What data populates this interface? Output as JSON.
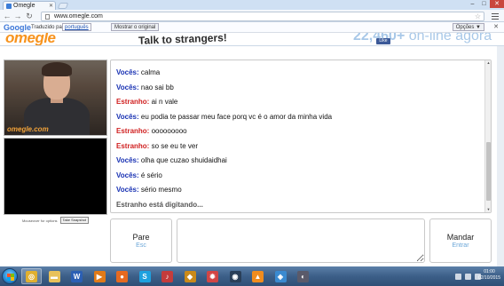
{
  "browser": {
    "tab_title": "Omegle",
    "url": "www.omegle.com",
    "translate_bar": {
      "logo": "Google",
      "label": "Traduzido para:",
      "language": "português",
      "show_original": "Mostrar o original",
      "options": "Opções ▼"
    }
  },
  "header": {
    "logo": "omegle",
    "tagline": "Talk to strangers!",
    "online_count": "22,460+",
    "online_label": " on-line agora",
    "like_label": "Like"
  },
  "video": {
    "watermark": "omegle.com",
    "footer_text": "Mouseover for options",
    "snapshot_button": "Take Snapshot"
  },
  "chat": {
    "messages": [
      {
        "sender": "Vocês:",
        "role": "you",
        "text": " calma"
      },
      {
        "sender": "Vocês:",
        "role": "you",
        "text": " nao sai bb"
      },
      {
        "sender": "Estranho:",
        "role": "stranger",
        "text": " ai n vale"
      },
      {
        "sender": "Vocês:",
        "role": "you",
        "text": " eu podia te passar meu face porq vc é o amor da minha vida"
      },
      {
        "sender": "Estranho:",
        "role": "stranger",
        "text": " ooooooooo"
      },
      {
        "sender": "Estranho:",
        "role": "stranger",
        "text": " so se eu te ver"
      },
      {
        "sender": "Vocês:",
        "role": "you",
        "text": " olha que cuzao shuidaidhai"
      },
      {
        "sender": "Vocês:",
        "role": "you",
        "text": " é sério"
      },
      {
        "sender": "Vocês:",
        "role": "you",
        "text": " sério mesmo"
      }
    ],
    "typing_status": "Estranho está digitando..."
  },
  "controls": {
    "stop_label": "Pare",
    "stop_key": "Esc",
    "send_label": "Mandar",
    "send_key": "Entrar",
    "message_value": ""
  },
  "taskbar": {
    "apps": [
      {
        "name": "chrome",
        "icon": "chrome-icon",
        "glyph": "◎",
        "color": "#e0b030"
      },
      {
        "name": "explorer",
        "icon": "folder-icon",
        "glyph": "▬",
        "color": "#e8c15a"
      },
      {
        "name": "word",
        "icon": "word-icon",
        "glyph": "W",
        "color": "#2b5fb4"
      },
      {
        "name": "vlc-player",
        "icon": "media-player-icon",
        "glyph": "▶",
        "color": "#e07a18"
      },
      {
        "name": "firefox",
        "icon": "firefox-icon",
        "glyph": "●",
        "color": "#e66a20"
      },
      {
        "name": "skype",
        "icon": "skype-icon",
        "glyph": "S",
        "color": "#1ea1df"
      },
      {
        "name": "media",
        "icon": "music-icon",
        "glyph": "♪",
        "color": "#c43c3c"
      },
      {
        "name": "winamp",
        "icon": "winamp-icon",
        "glyph": "◆",
        "color": "#c98a1a"
      },
      {
        "name": "settings",
        "icon": "gear-icon",
        "glyph": "✹",
        "color": "#d24545"
      },
      {
        "name": "steam",
        "icon": "steam-icon",
        "glyph": "◉",
        "color": "#2a3f58"
      },
      {
        "name": "app-orange",
        "icon": "orange-app-icon",
        "glyph": "▲",
        "color": "#f08c1e"
      },
      {
        "name": "app-blue",
        "icon": "blue-app-icon",
        "glyph": "◈",
        "color": "#3a8ad0"
      },
      {
        "name": "app-dark",
        "icon": "dark-app-icon",
        "glyph": "◐",
        "color": "#5a5a6a"
      }
    ],
    "time": "01:00",
    "date": "02/10/2015"
  }
}
